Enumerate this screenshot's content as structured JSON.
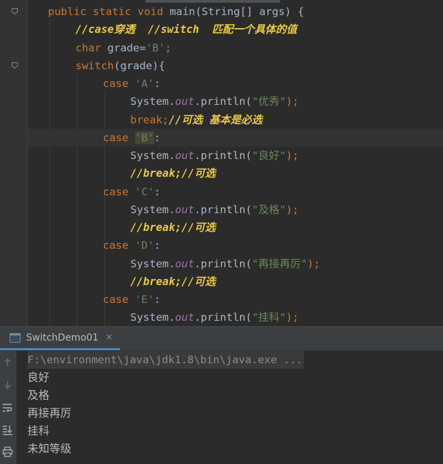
{
  "editor": {
    "lines": {
      "l1": {
        "kw": "public static void ",
        "rest": "main(String[] args) {"
      },
      "l2": {
        "comment": "//case穿透  //switch  匹配一个具体的值"
      },
      "l3": {
        "kw": "char ",
        "rest": "grade=",
        "str": "'B'",
        "end": ";"
      },
      "l4": {
        "kw": "switch",
        "rest": "(grade){"
      },
      "l5": {
        "kw": "case ",
        "str": "'A'",
        "end": ":"
      },
      "l6": {
        "pre": "System.",
        "field": "out",
        "mid": ".println(",
        "str": "\"优秀\"",
        "end": ");"
      },
      "l7": {
        "kw": "break",
        "semi": ";",
        "comment": "//可选 基本是必选"
      },
      "l8": {
        "kw": "case ",
        "str": "'B'",
        "end": ":"
      },
      "l9": {
        "pre": "System.",
        "field": "out",
        "mid": ".println(",
        "str": "\"良好\"",
        "end": ");"
      },
      "l10": {
        "comment": "//break;//可选"
      },
      "l11": {
        "kw": "case ",
        "str": "'C'",
        "end": ":"
      },
      "l12": {
        "pre": "System.",
        "field": "out",
        "mid": ".println(",
        "str": "\"及格\"",
        "end": ");"
      },
      "l13": {
        "comment": "//break;//可选"
      },
      "l14": {
        "kw": "case ",
        "str": "'D'",
        "end": ":"
      },
      "l15": {
        "pre": "System.",
        "field": "out",
        "mid": ".println(",
        "str": "\"再接再厉\"",
        "end": ");"
      },
      "l16": {
        "comment": "//break;//可选"
      },
      "l17": {
        "kw": "case ",
        "str": "'E'",
        "end": ":"
      },
      "l18": {
        "pre": "System.",
        "field": "out",
        "mid": ".println(",
        "str": "\"挂科\"",
        "end": ");"
      }
    }
  },
  "run_panel": {
    "tab_label": "SwitchDemo01",
    "close_glyph": "×",
    "tools": [
      "arrow-up-icon",
      "arrow-down-icon",
      "soft-wrap-icon",
      "scroll-to-end-icon",
      "print-icon"
    ],
    "output": {
      "command": "F:\\environment\\java\\jdk1.8\\bin\\java.exe ...",
      "line1": "良好",
      "line2": "及格",
      "line3": "再接再厉",
      "line4": "挂科",
      "line5": "未知等级"
    }
  },
  "colors": {
    "keyword": "#cc7832",
    "string": "#6a8759",
    "field": "#9876aa",
    "comment": "#e8c846",
    "text": "#a9b7c6",
    "background": "#2b2b2b"
  }
}
